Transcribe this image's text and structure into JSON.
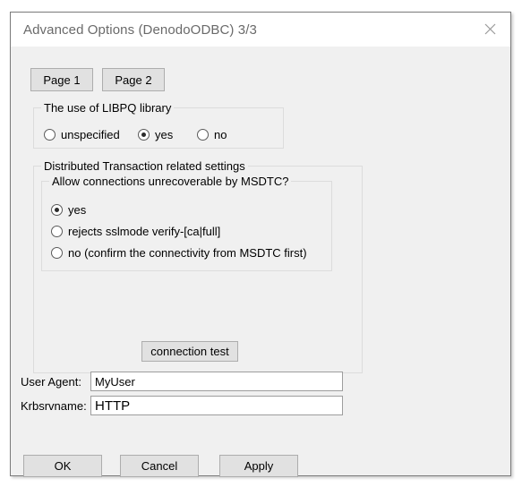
{
  "window": {
    "title": "Advanced Options (DenodoODBC) 3/3",
    "close_icon": "close-icon"
  },
  "tabs": [
    {
      "label": "Page 1"
    },
    {
      "label": "Page 2"
    }
  ],
  "libpq_group": {
    "legend": "The use of LIBPQ library",
    "options": [
      {
        "label": "unspecified",
        "selected": false
      },
      {
        "label": "yes",
        "selected": true
      },
      {
        "label": "no",
        "selected": false
      }
    ]
  },
  "distributed_transaction_group": {
    "legend": "Distributed Transaction related settings",
    "msdtc_group": {
      "legend": "Allow connections unrecoverable by MSDTC?",
      "options": [
        {
          "label": "yes",
          "selected": true
        },
        {
          "label": "rejects sslmode verify-[ca|full]",
          "selected": false
        },
        {
          "label": "no (confirm the connectivity from MSDTC first)",
          "selected": false
        }
      ]
    },
    "connection_test_label": "connection test"
  },
  "fields": [
    {
      "label": "User Agent:",
      "value": "MyUser"
    },
    {
      "label": "Krbsrvname:",
      "value": "HTTP"
    }
  ],
  "actions": {
    "ok": "OK",
    "cancel": "Cancel",
    "apply": "Apply"
  },
  "colors": {
    "dialog_background": "#f0f0f0",
    "titlebar_background": "#ffffff",
    "title_text": "#6a6a6a",
    "button_face": "#e1e1e1",
    "button_border": "#adadad",
    "groupbox_border": "#dcdcdc",
    "input_background": "#ffffff",
    "text": "#000000"
  }
}
